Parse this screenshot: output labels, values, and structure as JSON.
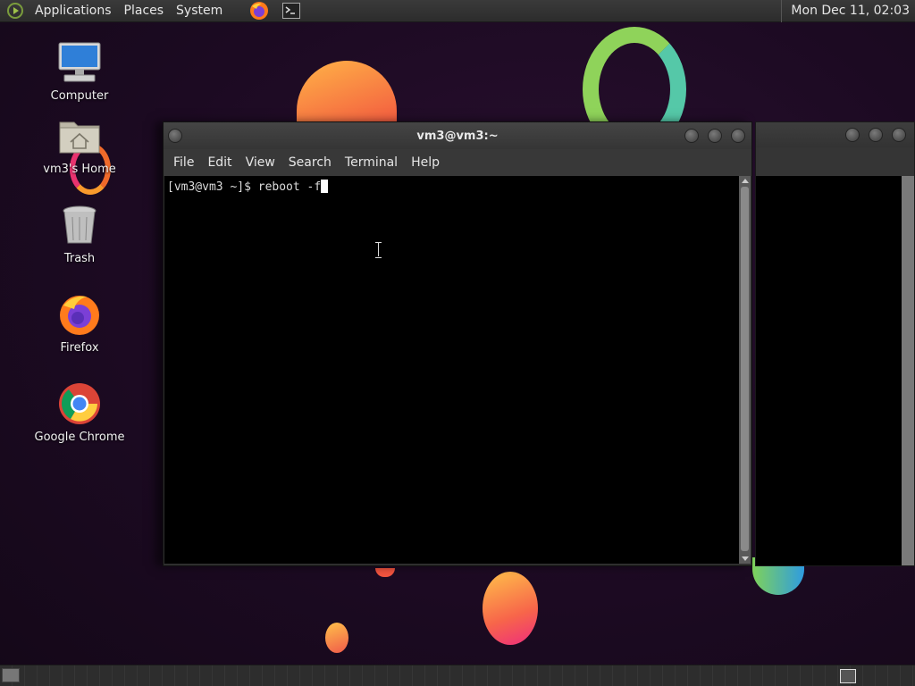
{
  "top_panel": {
    "menus": [
      "Applications",
      "Places",
      "System"
    ],
    "clock": "Mon Dec 11, 02:03"
  },
  "desktop_icons": [
    {
      "label": "Computer",
      "icon": "computer-icon"
    },
    {
      "label": "vm3's Home",
      "icon": "home-folder-icon"
    },
    {
      "label": "Trash",
      "icon": "trash-icon"
    },
    {
      "label": "Firefox",
      "icon": "firefox-icon"
    },
    {
      "label": "Google Chrome",
      "icon": "chrome-icon"
    }
  ],
  "terminal": {
    "title": "vm3@vm3:~",
    "menus": [
      "File",
      "Edit",
      "View",
      "Search",
      "Terminal",
      "Help"
    ],
    "prompt": "[vm3@vm3 ~]$ ",
    "command": "reboot -f"
  },
  "colors": {
    "panel": "#2c2c2c",
    "terminal_bg": "#000000",
    "terminal_fg": "#dcdcdc",
    "desktop_bg": "#1c0a22"
  }
}
